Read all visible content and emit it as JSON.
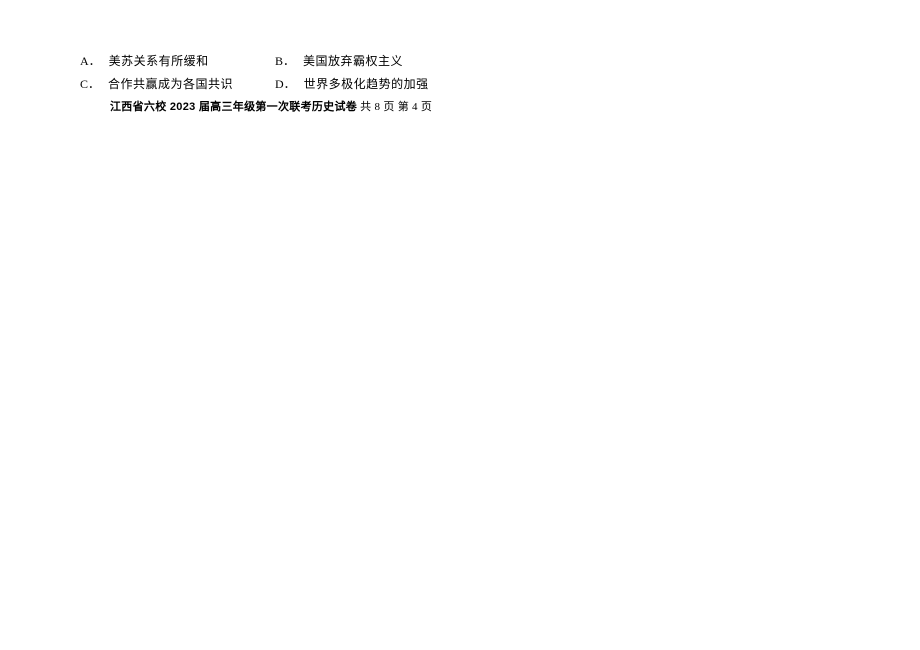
{
  "options": {
    "a": {
      "label": "A．",
      "text": "美苏关系有所缓和"
    },
    "b": {
      "label": "B．",
      "text": "美国放弃霸权主义"
    },
    "c": {
      "label": "C．",
      "text": "合作共赢成为各国共识"
    },
    "d": {
      "label": "D．",
      "text": "世界多极化趋势的加强"
    }
  },
  "footer": {
    "bold": "江西省六校 2023 届高三年级第一次联考历史试卷",
    "pages": "共 8 页 第 4 页"
  }
}
